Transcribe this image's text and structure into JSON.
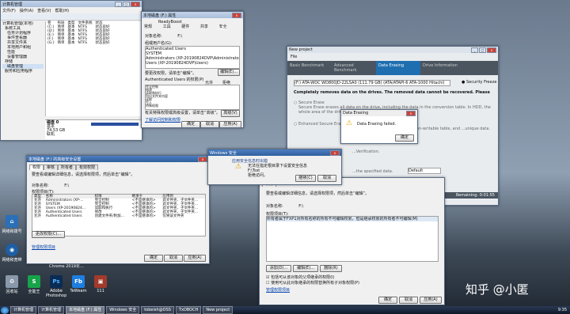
{
  "comp_mgmt": {
    "title": "计算机管理",
    "menu": [
      "文件(F)",
      "操作(A)",
      "查看(V)",
      "帮助(H)"
    ],
    "tree": [
      "计算机管理(本地)",
      "系统工具",
      "任务计划程序",
      "事件查看器",
      "共享文件夹",
      "本地用户和组",
      "性能",
      "设备管理器",
      "存储",
      "磁盘管理",
      "服务和应用程序"
    ],
    "columns": [
      "卷",
      "布局",
      "类型",
      "文件系统",
      "状态"
    ],
    "vols": [
      [
        "(C:)",
        "简单",
        "基本",
        "NTFS",
        "状态良好"
      ],
      [
        "(D:)",
        "简单",
        "基本",
        "NTFS",
        "状态良好"
      ],
      [
        "(E:)",
        "简单",
        "基本",
        "NTFS",
        "状态良好"
      ],
      [
        "(F:)",
        "简单",
        "基本",
        "NTFS",
        "状态良好"
      ],
      [
        "(G:)",
        "简单",
        "基本",
        "NTFS",
        "状态良好"
      ]
    ],
    "disk_label": "磁盘 0",
    "disk_type": "基本",
    "disk_size": "74.53 GB",
    "disk_status": "联机"
  },
  "props_small": {
    "title": "本地磁盘 (F:) 属性",
    "tabs": [
      "ReadyBoost",
      "常规",
      "工具",
      "硬件",
      "共享",
      "安全"
    ],
    "object_label": "对象名称:",
    "object_value": "F:\\",
    "group_label": "组或用户名(G):",
    "users": [
      "Authenticated Users",
      "SYSTEM",
      "Administrators (XP-20190824DVP\\Administrators)",
      "Users (XP-20190824DVP\\Users)"
    ],
    "edit_hint": "要更改权限，请单击“编辑”。",
    "edit_btn": "编辑(E)...",
    "perm_for": "Authenticated Users 的权限(P)",
    "allow": "允许",
    "deny": "拒绝",
    "perms": [
      "完全控制",
      "修改",
      "读取和执行",
      "列出文件夹内容",
      "读取",
      "写入",
      "特殊权限"
    ],
    "adv_hint": "有关特殊权限或高级设置，请单击“高级”。",
    "adv_btn": "高级(V)",
    "link": "了解访问控制和权限",
    "ok": "确定",
    "cancel": "取消",
    "apply": "应用(A)"
  },
  "adv_sec": {
    "title": "本地磁盘 (F:) 的高级安全设置",
    "tabs": [
      "权限",
      "审核",
      "所有者",
      "有效权限"
    ],
    "hint": "要查看或编辑详细信息，请选择权限项，然后单击“编辑”。",
    "obj_label": "对象名称:",
    "obj_value": "F:\\",
    "list_label": "权限项目(T):",
    "cols": [
      "类型",
      "名称",
      "权限",
      "继承于",
      "应用到"
    ],
    "rows": [
      [
        "允许",
        "Administrators (XP-...",
        "完全控制",
        "<不是继承的>",
        "此文件夹、子文件夹..."
      ],
      [
        "允许",
        "SYSTEM",
        "完全控制",
        "<不是继承的>",
        "此文件夹、子文件夹..."
      ],
      [
        "允许",
        "Users (XP-20190824...",
        "读取和执行",
        "<不是继承的>",
        "此文件夹、子文件夹..."
      ],
      [
        "允许",
        "Authenticated Users",
        "修改",
        "<不是继承的>",
        "此文件夹、子文件夹..."
      ],
      [
        "允许",
        "Authenticated Users",
        "创建文件夹/附加...",
        "<不是继承的>",
        "仅将该文件夹"
      ]
    ],
    "change_btn": "更改权限(C)...",
    "link": "管理权限项目",
    "ok": "确定",
    "cancel": "取消",
    "apply": "应用(A)"
  },
  "win_sec": {
    "title": "Windows 安全",
    "header": "应用安全信息时出错",
    "msg": "无法在指定根目录下设置安全信息",
    "path": "F:\\Tsst",
    "denied": "拒绝访问。",
    "continue": "继续(C)",
    "cancel": "取消"
  },
  "sec_dialog2": {
    "tab": "权限",
    "hint": "要查看或编辑详细信息，请选择权限项，然后单击“编辑”。",
    "obj_label": "对象名称:",
    "obj_value": "F:\\",
    "list_label": "权限项目(T):",
    "selected": "所有者属于FXP1对所有名称的所有不可编辑权限，但是继承权限的所有者不可编辑(M)",
    "add": "添加(D)...",
    "edit": "编辑(E)...",
    "delete": "删除(R)",
    "inherit": "包括可从该对象的父项继承的权限(I)",
    "replace": "使用可从此对象继承的权限替换所有子对象权限(P)",
    "link": "管理权限项目",
    "ok": "确定",
    "cancel": "取消",
    "apply": "应用(A)"
  },
  "drive": {
    "title": "New project",
    "menu": "File",
    "tabs": [
      "Basic Benchmark",
      "Advanced Benchmark",
      "Data Erasing",
      "Drive Information"
    ],
    "drive_name": "(F:) ATA-WDC WD800JD-22LSA0 (111.79 GB) (ATA/ATAPI-6 ATA-1000 Hitachi)",
    "security": "Security Freeze",
    "warn": "Completely removes data on the drives. The removed data cannot be recovered. Please be careful.",
    "opt1": "Secure Erase",
    "opt1_desc": "Secure Erase erases all data on the drive, including the data in the conversion table. In HDD, the whole area of the drive is written with zero data.",
    "opt2": "Enhanced Secure Erase",
    "opt2_desc": "...physical non-writable table, and ...unique data.",
    "more": "...Verification.",
    "spec": "...the specified data.",
    "mode": "Default",
    "status": "Remaining: 0:01:55"
  },
  "erase_err": {
    "title": "Data Erasing",
    "msg": "Data Erasing failed.",
    "ok": "确定"
  },
  "desktop": {
    "icons": [
      "网络和拨号",
      "网络和宽带",
      "回收站",
      "全能王",
      "Adobe Photoshop",
      "TeWeam",
      "111"
    ],
    "chrome": "Chrome",
    "date": "2019年...",
    "watermark": "知乎 @小匿"
  },
  "taskbar": {
    "items": [
      "计算机管理",
      "计算机管理",
      "本地磁盘 (F:) 属性",
      "Windows 安全",
      "tobeish@OSS",
      "TxDBOCH",
      "New project"
    ],
    "time": "9:35"
  }
}
